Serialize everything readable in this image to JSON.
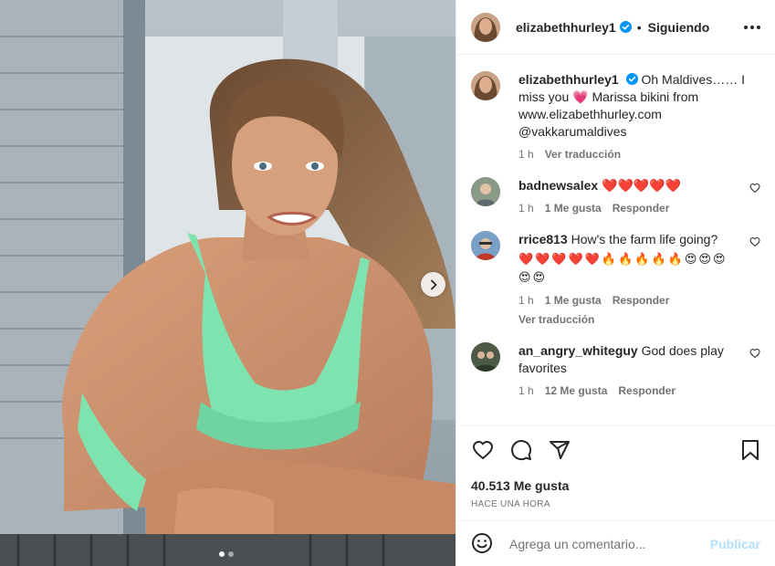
{
  "post": {
    "author": "elizabethhurley1",
    "separator": "•",
    "follow_status": "Siguiendo"
  },
  "caption": {
    "username": "elizabethhurley1",
    "text": "Oh Maldives…… I miss you",
    "emoji": "💗",
    "text2": "Marissa bikini from www.elizabethhurley.com @vakkarumaldives",
    "time": "1 h",
    "translate": "Ver traducción"
  },
  "comments": [
    {
      "username": "badnewsalex",
      "text": "❤️❤️❤️❤️❤️",
      "time": "1 h",
      "likes": "1 Me gusta",
      "reply": "Responder",
      "translate": ""
    },
    {
      "username": "rrice813",
      "text": "How's the farm life going?",
      "emoji_line": "❤️❤️❤️❤️❤️🔥🔥🔥🔥🔥😍😍😍😍😍",
      "time": "1 h",
      "likes": "1 Me gusta",
      "reply": "Responder",
      "translate": "Ver traducción"
    },
    {
      "username": "an_angry_whiteguy",
      "text": "God does play favorites",
      "time": "1 h",
      "likes": "12 Me gusta",
      "reply": "Responder",
      "translate": ""
    }
  ],
  "stats": {
    "likes": "40.513 Me gusta",
    "posted": "HACE UNA HORA"
  },
  "comment_box": {
    "placeholder": "Agrega un comentario...",
    "publish": "Publicar"
  },
  "carousel": {
    "slides": 2,
    "active": 1
  },
  "colors": {
    "verified": "#0095f6",
    "publish": "#b2dffc",
    "bikini": "#7fe3b0"
  },
  "icons": [
    "verified-icon",
    "more-icon",
    "heart-icon",
    "comment-icon",
    "share-icon",
    "save-icon",
    "emoji-icon",
    "chevron-right-icon"
  ]
}
